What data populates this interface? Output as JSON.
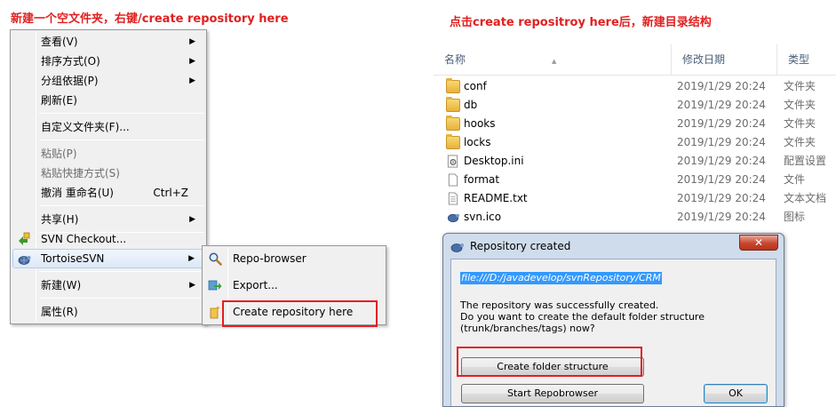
{
  "captions": {
    "left": "新建一个空文件夹，右键/create repository here",
    "right": "点击create repositroy here后，新建目录结构"
  },
  "context_menu": {
    "items": [
      {
        "label": "查看(V)",
        "arrow": "▶"
      },
      {
        "label": "排序方式(O)",
        "arrow": "▶"
      },
      {
        "label": "分组依据(P)",
        "arrow": "▶"
      },
      {
        "label": "刷新(E)"
      },
      {
        "label": "自定义文件夹(F)..."
      },
      {
        "label": "粘贴(P)"
      },
      {
        "label": "粘贴快捷方式(S)"
      },
      {
        "label": "撤消 重命名(U)",
        "shortcut": "Ctrl+Z"
      },
      {
        "label": "共享(H)",
        "arrow": "▶"
      },
      {
        "label": "SVN Checkout..."
      },
      {
        "label": "TortoiseSVN",
        "arrow": "▶"
      },
      {
        "label": "新建(W)",
        "arrow": "▶"
      },
      {
        "label": "属性(R)"
      }
    ]
  },
  "submenu": {
    "items": [
      {
        "label": "Repo-browser",
        "icon": "magnifier-icon"
      },
      {
        "label": "Export...",
        "icon": "export-icon"
      },
      {
        "label": "Create repository here",
        "icon": "create-repo-icon"
      }
    ]
  },
  "explorer": {
    "columns": {
      "name": "名称",
      "date": "修改日期",
      "type": "类型"
    },
    "files": [
      {
        "name": "conf",
        "date": "2019/1/29 20:24",
        "type": "文件夹",
        "icon": "folder-icon"
      },
      {
        "name": "db",
        "date": "2019/1/29 20:24",
        "type": "文件夹",
        "icon": "folder-icon"
      },
      {
        "name": "hooks",
        "date": "2019/1/29 20:24",
        "type": "文件夹",
        "icon": "folder-icon"
      },
      {
        "name": "locks",
        "date": "2019/1/29 20:24",
        "type": "文件夹",
        "icon": "folder-icon"
      },
      {
        "name": "Desktop.ini",
        "date": "2019/1/29 20:24",
        "type": "配置设置",
        "icon": "settings-file-icon"
      },
      {
        "name": "format",
        "date": "2019/1/29 20:24",
        "type": "文件",
        "icon": "file-icon"
      },
      {
        "name": "README.txt",
        "date": "2019/1/29 20:24",
        "type": "文本文档",
        "icon": "text-file-icon"
      },
      {
        "name": "svn.ico",
        "date": "2019/1/29 20:24",
        "type": "图标",
        "icon": "svn-icon"
      }
    ]
  },
  "dialog": {
    "title": "Repository created",
    "close": "✕",
    "path": "file:///D:/javadevelop/svnRepository/CRM",
    "message_line1": "The repository was successfully created.",
    "message_line2": "Do you want to create the default folder structure",
    "message_line3": "(trunk/branches/tags) now?",
    "btn_create": "Create folder structure",
    "btn_repobrowser": "Start Repobrowser",
    "btn_ok": "OK"
  },
  "colors": {
    "highlight_box": "#e51c23",
    "caption": "#e02020",
    "selection": "#3399ff"
  }
}
